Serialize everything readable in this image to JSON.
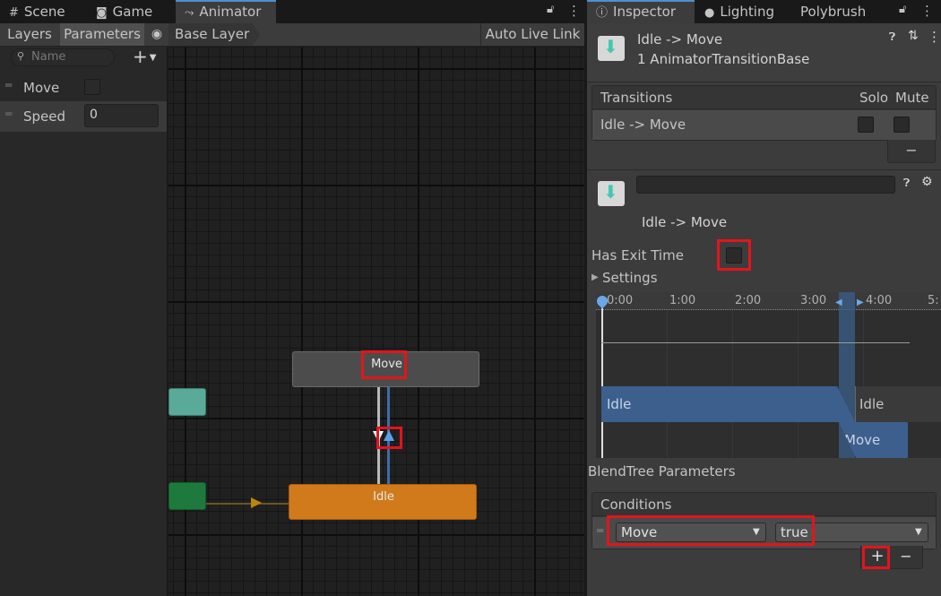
{
  "left_tabs": [
    {
      "label": "Scene",
      "icon": "grid-icon"
    },
    {
      "label": "Game",
      "icon": "gamepad-icon"
    },
    {
      "label": "Animator",
      "icon": "animator-icon"
    }
  ],
  "animator": {
    "layers_label": "Layers",
    "parameters_label": "Parameters",
    "base_layer": "Base Layer",
    "auto_live_link": "Auto Live Link",
    "search_placeholder": "Name",
    "add_symbol": "+",
    "params": [
      {
        "name": "Move",
        "type": "bool"
      },
      {
        "name": "Speed",
        "type": "float",
        "value": "0"
      }
    ],
    "nodes": {
      "move": "Move",
      "idle": "Idle"
    }
  },
  "right_tabs": [
    {
      "label": "Inspector",
      "icon": "info-icon"
    },
    {
      "label": "Lighting",
      "icon": "bulb-icon"
    },
    {
      "label": "Polybrush",
      "icon": ""
    }
  ],
  "inspector": {
    "title": "Idle -> Move",
    "subtitle": "1 AnimatorTransitionBase",
    "transitions_header": "Transitions",
    "solo": "Solo",
    "mute": "Mute",
    "transition_row": "Idle -> Move",
    "minus": "−",
    "transition_name": "Idle -> Move",
    "has_exit_time": "Has Exit Time",
    "settings": "Settings",
    "timeline_labels": [
      "0:00",
      "1:00",
      "2:00",
      "3:00",
      "4:00",
      "5:"
    ],
    "clip_idle": "Idle",
    "clip_idle_2": "Idle",
    "clip_move": "Move",
    "blendtree": "BlendTree Parameters",
    "conditions": "Conditions",
    "condition_param": "Move",
    "condition_value": "true",
    "plus": "+",
    "minus2": "−"
  }
}
